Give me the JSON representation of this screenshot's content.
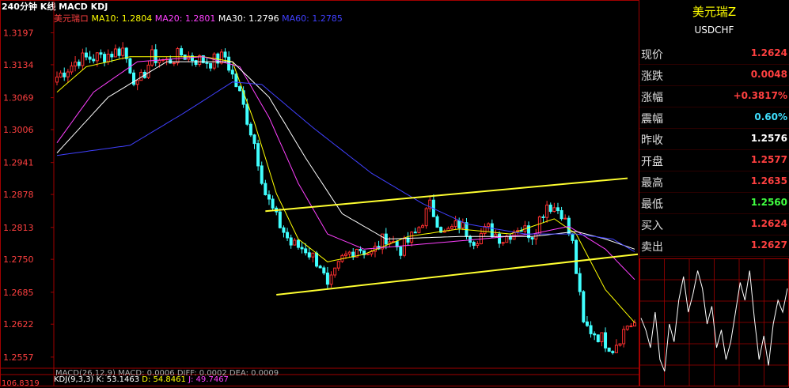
{
  "header": {
    "title": "240分钟 K线 MACD KDJ"
  },
  "ma_legend": [
    {
      "label": "美元瑞ロ",
      "color": "#ff4040"
    },
    {
      "label": "MA10: 1.2804",
      "color": "#ffff00"
    },
    {
      "label": "MA20: 1.2801",
      "color": "#ff40ff"
    },
    {
      "label": "MA30: 1.2796",
      "color": "#ffffff"
    },
    {
      "label": "MA60: 1.2785",
      "color": "#4040ff"
    }
  ],
  "macd_legend": "MACD(26,12,9)  MACD: 0.0006  DIFF: 0.0002  DEA: 0.0009",
  "kdj_legend": [
    {
      "label": "KDJ(9,3,3)",
      "color": "#ffffff"
    },
    {
      "label": "K: 53.1463",
      "color": "#ffffff"
    },
    {
      "label": "D: 54.8461",
      "color": "#ffff00"
    },
    {
      "label": "J: 49.7467",
      "color": "#ff40ff"
    }
  ],
  "bottom_value": "106.8319",
  "quote": {
    "name": "美元瑞Z",
    "code": "USDCHF",
    "rows": [
      {
        "label": "现价",
        "value": "1.2624",
        "color": "#ff4040"
      },
      {
        "label": "涨跌",
        "value": "0.0048",
        "color": "#ff4040"
      },
      {
        "label": "涨幅",
        "value": "+0.3817%",
        "color": "#ff4040"
      },
      {
        "label": "震幅",
        "value": "0.60%",
        "color": "#40e0ff"
      },
      {
        "label": "昨收",
        "value": "1.2576",
        "color": "#ffffff"
      },
      {
        "label": "开盘",
        "value": "1.2577",
        "color": "#ff4040"
      },
      {
        "label": "最高",
        "value": "1.2635",
        "color": "#ff4040"
      },
      {
        "label": "最低",
        "value": "1.2560",
        "color": "#40ff40"
      },
      {
        "label": "买入",
        "value": "1.2624",
        "color": "#ff4040"
      },
      {
        "label": "卖出",
        "value": "1.2627",
        "color": "#ff4040"
      }
    ]
  },
  "chart_data": {
    "type": "candlestick",
    "ylim": [
      1.2535,
      1.3215
    ],
    "yticks": [
      "1.3197",
      "1.3134",
      "1.3069",
      "1.3006",
      "1.2941",
      "1.2878",
      "1.2813",
      "1.2750",
      "1.2685",
      "1.2622",
      "1.2557"
    ],
    "ytick_values": [
      1.3197,
      1.3134,
      1.3069,
      1.3006,
      1.2941,
      1.2878,
      1.2813,
      1.275,
      1.2685,
      1.2622,
      1.2557
    ],
    "ohlc_anchors": [
      {
        "i": 0,
        "c": 1.311
      },
      {
        "i": 6,
        "c": 1.3145
      },
      {
        "i": 12,
        "c": 1.315
      },
      {
        "i": 18,
        "c": 1.3165
      },
      {
        "i": 22,
        "c": 1.309
      },
      {
        "i": 26,
        "c": 1.315
      },
      {
        "i": 30,
        "c": 1.314
      },
      {
        "i": 34,
        "c": 1.3155
      },
      {
        "i": 38,
        "c": 1.3145
      },
      {
        "i": 42,
        "c": 1.314
      },
      {
        "i": 46,
        "c": 1.315
      },
      {
        "i": 50,
        "c": 1.3075
      },
      {
        "i": 54,
        "c": 1.298
      },
      {
        "i": 57,
        "c": 1.288
      },
      {
        "i": 60,
        "c": 1.283
      },
      {
        "i": 64,
        "c": 1.278
      },
      {
        "i": 68,
        "c": 1.277
      },
      {
        "i": 72,
        "c": 1.274
      },
      {
        "i": 74,
        "c": 1.269
      },
      {
        "i": 78,
        "c": 1.275
      },
      {
        "i": 82,
        "c": 1.2775
      },
      {
        "i": 86,
        "c": 1.276
      },
      {
        "i": 90,
        "c": 1.2795
      },
      {
        "i": 94,
        "c": 1.277
      },
      {
        "i": 98,
        "c": 1.28
      },
      {
        "i": 102,
        "c": 1.2855
      },
      {
        "i": 106,
        "c": 1.28
      },
      {
        "i": 110,
        "c": 1.282
      },
      {
        "i": 114,
        "c": 1.279
      },
      {
        "i": 118,
        "c": 1.281
      },
      {
        "i": 122,
        "c": 1.279
      },
      {
        "i": 126,
        "c": 1.2815
      },
      {
        "i": 130,
        "c": 1.28
      },
      {
        "i": 134,
        "c": 1.286
      },
      {
        "i": 138,
        "c": 1.2845
      },
      {
        "i": 141,
        "c": 1.278
      },
      {
        "i": 144,
        "c": 1.262
      },
      {
        "i": 148,
        "c": 1.26
      },
      {
        "i": 152,
        "c": 1.2575
      },
      {
        "i": 156,
        "c": 1.262
      },
      {
        "i": 158,
        "c": 1.2624
      }
    ],
    "candle_count": 159,
    "ma": [
      {
        "name": "MA10",
        "color": "#ffff00",
        "anchors": [
          [
            0,
            1.308
          ],
          [
            8,
            1.313
          ],
          [
            20,
            1.315
          ],
          [
            40,
            1.315
          ],
          [
            48,
            1.314
          ],
          [
            54,
            1.302
          ],
          [
            60,
            1.288
          ],
          [
            66,
            1.279
          ],
          [
            74,
            1.2745
          ],
          [
            84,
            1.276
          ],
          [
            96,
            1.2795
          ],
          [
            110,
            1.281
          ],
          [
            124,
            1.28
          ],
          [
            136,
            1.283
          ],
          [
            142,
            1.28
          ],
          [
            150,
            1.269
          ],
          [
            158,
            1.2625
          ]
        ]
      },
      {
        "name": "MA20",
        "color": "#ff40ff",
        "anchors": [
          [
            0,
            1.298
          ],
          [
            10,
            1.308
          ],
          [
            22,
            1.314
          ],
          [
            40,
            1.315
          ],
          [
            50,
            1.313
          ],
          [
            58,
            1.303
          ],
          [
            66,
            1.29
          ],
          [
            74,
            1.28
          ],
          [
            84,
            1.277
          ],
          [
            100,
            1.278
          ],
          [
            116,
            1.279
          ],
          [
            130,
            1.28
          ],
          [
            140,
            1.2815
          ],
          [
            150,
            1.277
          ],
          [
            158,
            1.271
          ]
        ]
      },
      {
        "name": "MA30",
        "color": "#ffffff",
        "anchors": [
          [
            0,
            1.296
          ],
          [
            14,
            1.307
          ],
          [
            30,
            1.314
          ],
          [
            48,
            1.314
          ],
          [
            58,
            1.307
          ],
          [
            68,
            1.295
          ],
          [
            78,
            1.284
          ],
          [
            90,
            1.279
          ],
          [
            110,
            1.2795
          ],
          [
            130,
            1.2795
          ],
          [
            142,
            1.2805
          ],
          [
            150,
            1.279
          ],
          [
            158,
            1.277
          ]
        ]
      },
      {
        "name": "MA60",
        "color": "#4040ff",
        "anchors": [
          [
            0,
            1.2955
          ],
          [
            20,
            1.2975
          ],
          [
            35,
            1.304
          ],
          [
            48,
            1.31
          ],
          [
            56,
            1.3095
          ],
          [
            70,
            1.301
          ],
          [
            86,
            1.292
          ],
          [
            100,
            1.286
          ],
          [
            112,
            1.282
          ],
          [
            128,
            1.28
          ],
          [
            142,
            1.28
          ],
          [
            152,
            1.279
          ],
          [
            158,
            1.2765
          ]
        ]
      }
    ],
    "channel": [
      {
        "from": [
          1.2845,
          57
        ],
        "to": [
          1.291,
          130
        ]
      },
      {
        "from": [
          1.268,
          60
        ],
        "to": [
          1.276,
          158
        ]
      }
    ],
    "kdj_mini": [
      0.55,
      0.45,
      0.3,
      0.6,
      0.2,
      0.1,
      0.5,
      0.35,
      0.7,
      0.9,
      0.6,
      0.75,
      0.95,
      0.8,
      0.5,
      0.65,
      0.3,
      0.45,
      0.2,
      0.35,
      0.6,
      0.85,
      0.7,
      0.95,
      0.55,
      0.2,
      0.4,
      0.15,
      0.5,
      0.7,
      0.6,
      0.8
    ]
  }
}
